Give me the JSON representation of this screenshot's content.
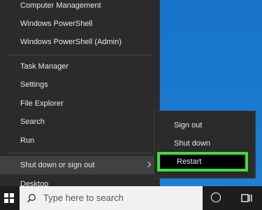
{
  "winx_menu": {
    "items": [
      {
        "label": "Computer Management",
        "name": "menu-item-computer-management"
      },
      {
        "label": "Windows PowerShell",
        "name": "menu-item-windows-powershell"
      },
      {
        "label": "Windows PowerShell (Admin)",
        "name": "menu-item-windows-powershell-admin"
      },
      {
        "label": "Task Manager",
        "name": "menu-item-task-manager"
      },
      {
        "label": "Settings",
        "name": "menu-item-settings"
      },
      {
        "label": "File Explorer",
        "name": "menu-item-file-explorer"
      },
      {
        "label": "Search",
        "name": "menu-item-search"
      },
      {
        "label": "Run",
        "name": "menu-item-run"
      },
      {
        "label": "Shut down or sign out",
        "name": "menu-item-shut-down-or-sign-out"
      },
      {
        "label": "Desktop",
        "name": "menu-item-desktop"
      }
    ]
  },
  "submenu": {
    "sign_out": "Sign out",
    "shut_down": "Shut down",
    "restart": "Restart"
  },
  "taskbar": {
    "search_placeholder": "Type here to search"
  },
  "colors": {
    "menu_bg": "#2b2b2b",
    "highlight_border": "#3ce03c",
    "desktop": "#1976c9"
  }
}
